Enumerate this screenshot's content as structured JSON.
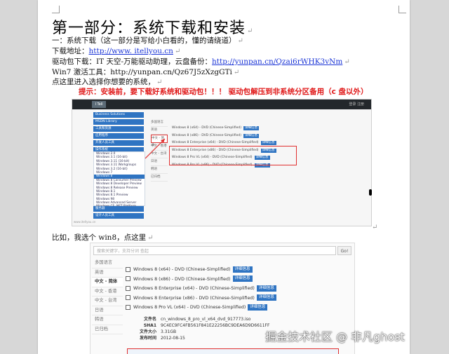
{
  "doc": {
    "title": "第一部分：系统下载和安装",
    "para_mark": "↵",
    "lines": {
      "l1": "一：系统下载（这一部分是写给小白看的，懂的请绕道）",
      "l2_prefix": "下载地址：",
      "l2_link": "http://www. itellyou.cn",
      "l3_prefix": "驱动包下载：IT 天空-万能驱动助理，云盘备份：",
      "l3_link": "http://yunpan.cn/Qzai6rWHK3vNm",
      "l4": "Win7 激活工具：http://yunpan.cn/Qz67J5zXzgGTi",
      "l5": "点这里进入选择你想要的系统，",
      "tip": "提示：安装前，要下载好系统和驱动包！！！ 驱动包解压到非系统分区备用（c 盘以外）",
      "l6": "比如，我选个 win8，点这里"
    }
  },
  "shot1": {
    "logo": "I Tell You",
    "top_right": "登录 注册",
    "menu": [
      "Business Solutions",
      "MSDN Library",
      "工具和资源",
      "应用程序",
      "开发人员工具",
      "操作系统"
    ],
    "list": [
      "Windows 2.0",
      "Windows 3.1 (16-bit)",
      "Windows 3.11 (16-bit)",
      "Windows 3.11 Workgroups",
      "Windows 3.2 (16-bit)",
      "Windows 7",
      "Windows 8",
      "Windows 8 Consumer Preview",
      "Windows 8 Developer Preview",
      "Windows 8 Release Preview",
      "Windows 8.1",
      "Windows 8.1 Preview",
      "Windows 98",
      "Windows Advanced Server",
      "Windows CE .NET Platform"
    ],
    "selected_index": 6,
    "menu2": [
      "服务器",
      "设计人员工具"
    ],
    "langs": [
      "多国语言",
      "英语",
      "中文 - 简体",
      "中文 - 香港",
      "中文 - 台湾",
      "日语",
      "韩语",
      "已归档"
    ],
    "files": [
      "Windows 8 (x64) - DVD (Chinese-Simplified)",
      "Windows 8 (x86) - DVD (Chinese-Simplified)",
      "Windows 8 Enterprise (x64) - DVD (Chinese-Simplified)",
      "Windows 8 Enterprise (x86) - DVD (Chinese-Simplified)",
      "Windows 8 Pro VL (x64) - DVD (Chinese-Simplified)",
      "Windows 8 Pro VL (x86) - DVD (Chinese-Simplified)"
    ],
    "btn": "详细信息",
    "caption": "www.itellyou.cn"
  },
  "shot2": {
    "search_placeholder": "搜索关键字，支持分词 查起",
    "go": "Go!",
    "langs": [
      "多国语言",
      "英语",
      "中文 - 简体",
      "中文 - 香港",
      "中文 - 台湾",
      "日语",
      "韩语",
      "已归档"
    ],
    "selected_lang": 2,
    "files": [
      "Windows 8 (x64) - DVD (Chinese-Simplified)",
      "Windows 8 (x86) - DVD (Chinese-Simplified)",
      "Windows 8 Enterprise (x64) - DVD (Chinese-Simplified)",
      "Windows 8 Enterprise (x86) - DVD (Chinese-Simplified)",
      "Windows 8 Pro VL (x64) - DVD (Chinese-Simplified)"
    ],
    "btn": "详细信息",
    "detail": {
      "name_k": "文件名",
      "name_v": "cn_windows_8_pro_vl_x64_dvd_917773.iso",
      "sha_k": "SHA1",
      "sha_v": "9C4EC9FC4FB561F841E22256BC9DEA6D9D6611FF",
      "size_k": "文件大小",
      "size_v": "3.31GB",
      "date_k": "发布时间",
      "date_v": "2012-08-15"
    }
  },
  "watermark": "掘金技术社区 @ 非凡ghost"
}
